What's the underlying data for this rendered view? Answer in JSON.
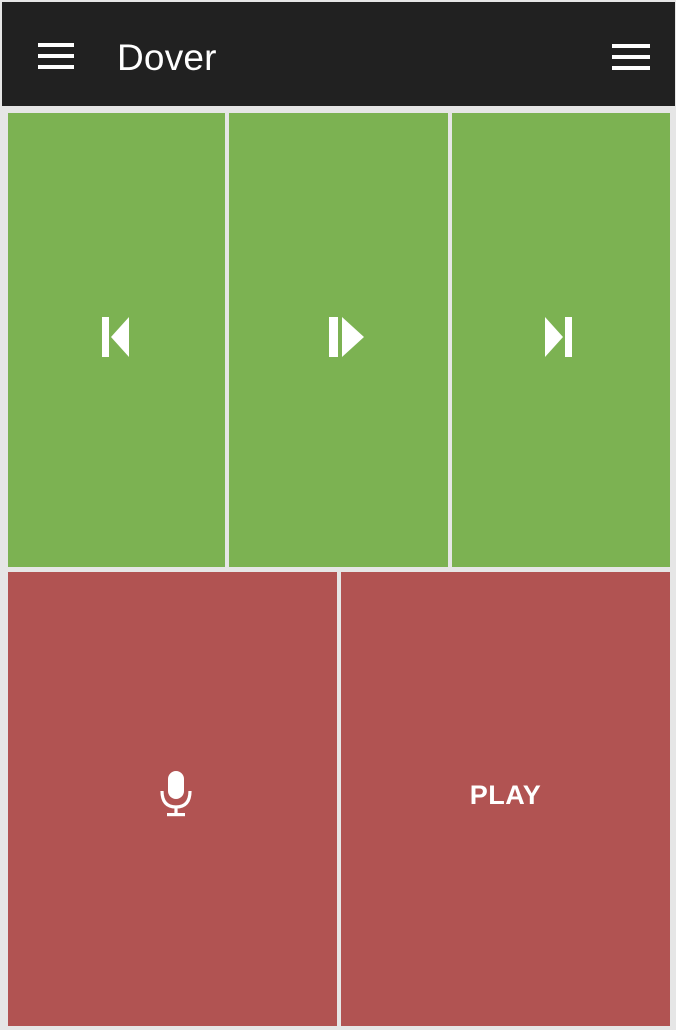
{
  "header": {
    "title": "Dover",
    "left_icon": "menu-icon",
    "right_icon": "list-icon"
  },
  "controls": {
    "row1": [
      {
        "id": "prev",
        "icon": "skip-previous-icon"
      },
      {
        "id": "pause",
        "icon": "play-pause-icon"
      },
      {
        "id": "next",
        "icon": "skip-next-icon"
      }
    ],
    "row2": [
      {
        "id": "mic",
        "icon": "microphone-icon"
      },
      {
        "id": "play",
        "label": "PLAY"
      }
    ]
  },
  "colors": {
    "header_bg": "#212121",
    "green": "#7cb252",
    "red": "#b15352",
    "divider": "#e6e6e6",
    "icon": "#ffffff"
  }
}
